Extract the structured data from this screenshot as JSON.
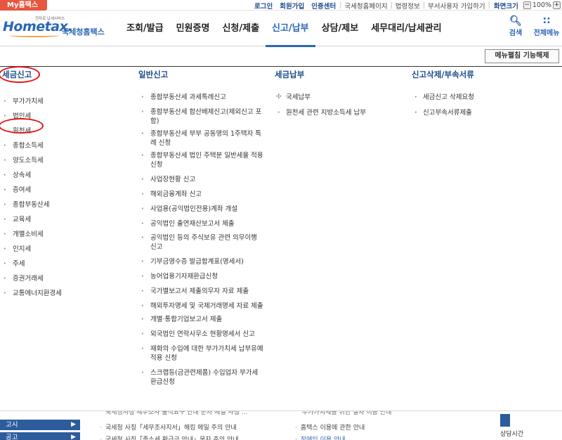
{
  "topbar": {
    "my_tax": "My홈택스",
    "links": [
      "로그인",
      "회원가입",
      "인증센터"
    ],
    "sublinks": [
      "국세청홈페이지",
      "법령정보",
      "부서사용자 가입하기"
    ],
    "zoom_label": "화면크기",
    "zoom_minus": "−",
    "zoom_value": "100%",
    "zoom_plus": "+"
  },
  "header": {
    "logo_small": "전자로 납세서비스",
    "logo_en": "Hometax.",
    "logo_ko": "국세청홈택스",
    "nav": [
      "조회/발급",
      "민원증명",
      "신청/제출",
      "신고/납부",
      "상담/제보",
      "세무대리/납세관리"
    ],
    "search_label": "검색",
    "search_icon": "search-icon",
    "allmenu_label": "전체메뉴",
    "allmenu_icon": "grid-icon"
  },
  "menu_close_label": "메뉴펼침 기능해제",
  "columns": {
    "tax_report": {
      "title": "세금신고",
      "items": [
        "부가가치세",
        "법인세",
        "원천세",
        "종합소득세",
        "양도소득세",
        "상속세",
        "증여세",
        "종합부동산세",
        "교육세",
        "개별소비세",
        "인지세",
        "주세",
        "증권거래세",
        "교통에너지환경세"
      ]
    },
    "general_report": {
      "title": "일반신고",
      "items": [
        "종합부동산세 과세특례신고",
        "종합부동산세 합산배제신고(제외신고 포함)",
        "종합부동산세 부부 공동명의 1주택자 특례 신청",
        "종합부동산세 법인 주택분 일반세율 적용 신청",
        "사업장현황 신고",
        "해외금융계좌 신고",
        "사업용(공익법인전용)계좌 개설",
        "공익법인 출연재산보고서 제출",
        "공익법인 등의 주식보유 관련 의무이행 신고",
        "기부금영수증 발급합계표(명세서)",
        "농어업용기자재환급신청",
        "국가별보고서 제출의무자 자료 제출",
        "해외투자명세 및 국제거래명세 자료 제출",
        "개별·통합기업보고서 제출",
        "외국법인 연락사무소 현황명세서 신고",
        "재화의 수입에 대한 부가가치세 납부유예 적용 신청",
        "스크랩등(금관련제품) 수입업자 부가세 환급신청"
      ]
    },
    "tax_payment": {
      "title": "세금납부",
      "items": [
        "국세납부",
        "원천세 관련 지방소득세 납부"
      ]
    },
    "report_delete": {
      "title": "신고삭제/부속서류",
      "items": [
        "세금신고 삭제요청",
        "신고부속서류제출"
      ]
    }
  },
  "bottom": {
    "side_buttons": [
      "고시",
      "공고"
    ],
    "notices_left": [
      "국세청 사칭「세무조사지서」해킹 메일 주의 안내",
      "국세청 사칭「종소세 환급금 안내」문자 주의 안내"
    ],
    "notices_right": [
      "홈택스 이용에 관한 안내",
      "장애인 이용 안내"
    ],
    "partial_top_left": "국세청사칭 세무조사 출석요구 안내 문자 메일 사칭 ...",
    "partial_top_right": "부가가치세를 위한 절차 이용 안내",
    "banner_label": "상담시간"
  }
}
